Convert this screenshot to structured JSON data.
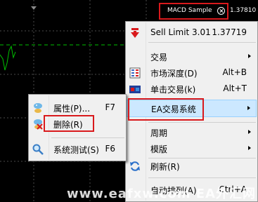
{
  "chart": {
    "ea_name": "MACD Sample",
    "price": "1.37810",
    "smile_icon": "smile-icon"
  },
  "watermark": "www.eafxw.com EA外汇网",
  "main_menu": {
    "items": [
      {
        "label": "Sell Limit 3.01",
        "shortcut": "1.37719",
        "icon": "sell-arrow-icon"
      },
      {
        "label": "交易",
        "shortcut": "",
        "icon": ""
      },
      {
        "label": "市场深度(D)",
        "shortcut": "Alt+B",
        "icon": "market-depth-icon"
      },
      {
        "label": "单击交易(k)",
        "shortcut": "Alt+T",
        "icon": "one-click-trading-icon"
      },
      {
        "label": "EA交易系统",
        "shortcut": "",
        "icon": ""
      },
      {
        "label": "周期",
        "shortcut": "",
        "icon": ""
      },
      {
        "label": "模版",
        "shortcut": "",
        "icon": ""
      },
      {
        "label": "刷新(R)",
        "shortcut": "",
        "icon": "refresh-icon"
      },
      {
        "label": "自动排列(A)",
        "shortcut": "Ctrl+A",
        "icon": ""
      }
    ]
  },
  "sub_menu": {
    "items": [
      {
        "label": "属性(P)...",
        "shortcut": "F7",
        "icon": "expert-properties-icon"
      },
      {
        "label": "删除(R)",
        "shortcut": "",
        "icon": "expert-remove-icon"
      },
      {
        "label": "系统测试(S)",
        "shortcut": "F6",
        "icon": "strategy-tester-icon"
      }
    ]
  },
  "colors": {
    "chart_bg": "#000000",
    "grid": "#4a4a4a",
    "price_line": "#00c000",
    "highlight": "#cce8ff",
    "annotation": "#d9191c"
  }
}
